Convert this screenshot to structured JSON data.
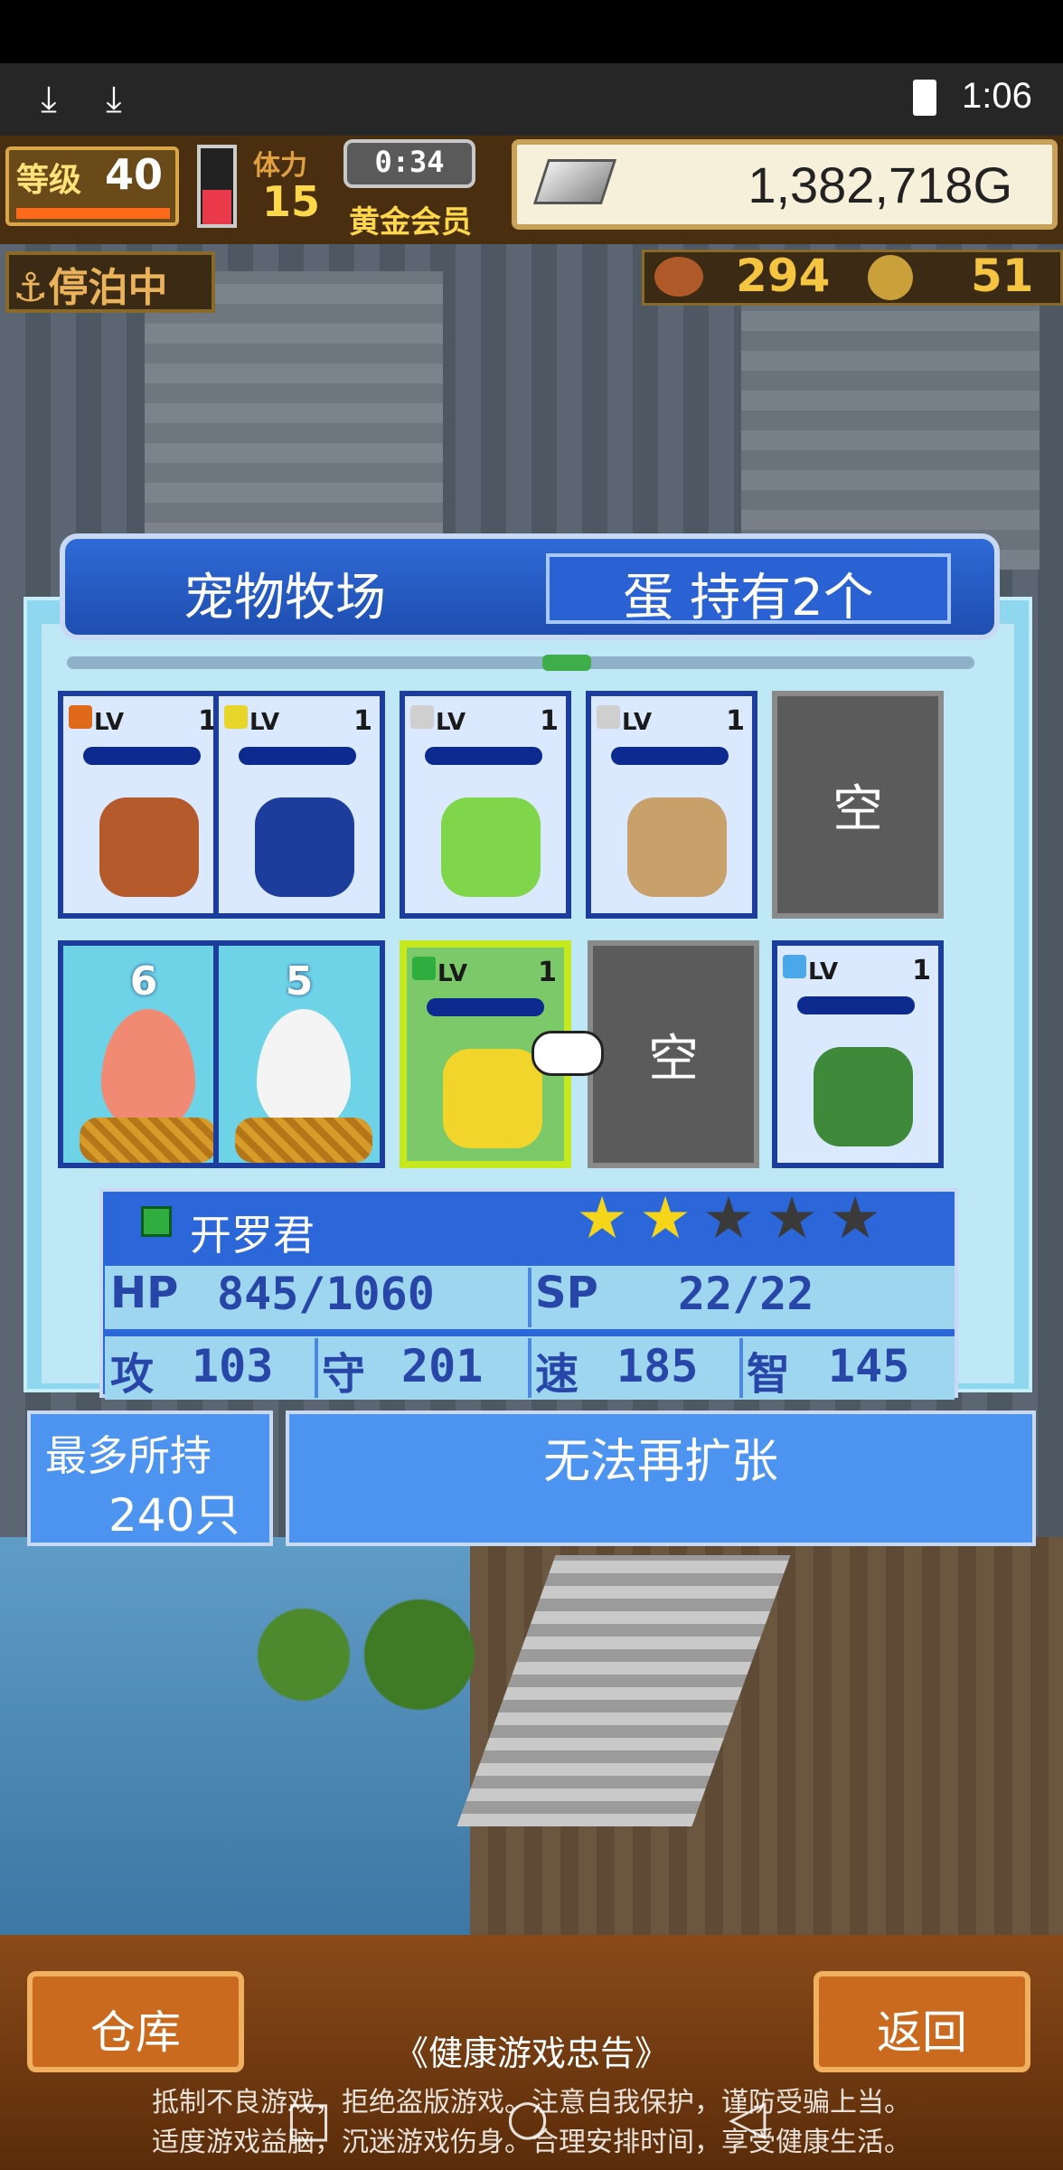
{
  "status": {
    "time": "1:06",
    "download_icons": [
      "download-icon",
      "download-icon"
    ]
  },
  "hud": {
    "level_label": "等级",
    "level": "40",
    "staff_label": "体力",
    "staff_count": "15",
    "timer": "0:34",
    "membership": "黄金会员",
    "money": "1,382,718G",
    "anchored": "⚓停泊中",
    "resource1": "294",
    "resource2": "51"
  },
  "panel": {
    "title": "宠物牧场",
    "eggs": "蛋 持有2个",
    "row1": [
      {
        "type": "pet",
        "lv_label": "LV",
        "level": "1",
        "element": "#e06a1a",
        "sprite_color": "#b55a2a"
      },
      {
        "type": "pet",
        "lv_label": "LV",
        "level": "1",
        "element": "#e8d52a",
        "sprite_color": "#1c3d9b"
      },
      {
        "type": "pet",
        "lv_label": "LV",
        "level": "1",
        "element": "#cfcfcf",
        "sprite_color": "#7fd64a"
      },
      {
        "type": "pet",
        "lv_label": "LV",
        "level": "1",
        "element": "#cfcfcf",
        "sprite_color": "#c8a06a"
      },
      {
        "type": "empty",
        "label": "空"
      }
    ],
    "row2": [
      {
        "type": "egg",
        "count": "6",
        "shell_color": "#f08a72"
      },
      {
        "type": "egg",
        "count": "5",
        "shell_color": "#f4f4f4"
      },
      {
        "type": "pet",
        "lv_label": "LV",
        "level": "1",
        "element": "#2fae3f",
        "sprite_color": "#f2d52a",
        "selected": true
      },
      {
        "type": "empty",
        "label": "空"
      },
      {
        "type": "pet",
        "lv_label": "LV",
        "level": "1",
        "element": "#4aa8e8",
        "sprite_color": "#3f8a3a"
      }
    ]
  },
  "info": {
    "name": "开罗君",
    "stars_filled": 2,
    "stars_total": 5,
    "hp_label": "HP",
    "hp": "845/1060",
    "sp_label": "SP",
    "sp": "22/22",
    "atk_label": "攻",
    "atk": "103",
    "def_label": "守",
    "def": "201",
    "spd_label": "速",
    "spd": "185",
    "int_label": "智",
    "int": "145"
  },
  "capacity": {
    "label": "最多所持",
    "value": "240只"
  },
  "expand": {
    "label": "无法再扩张"
  },
  "bottom": {
    "warehouse": "仓库",
    "back": "返回",
    "notice_title": "《健康游戏忠告》",
    "notice_line1": "抵制不良游戏，拒绝盗版游戏。注意自我保护，谨防受骗上当。",
    "notice_line2": "适度游戏益脑，沉迷游戏伤身。合理安排时间，享受健康生活。"
  },
  "colors": {
    "panel_blue": "#2b67d8",
    "selected_border": "#c6e81f",
    "star": "#f5d51a"
  }
}
